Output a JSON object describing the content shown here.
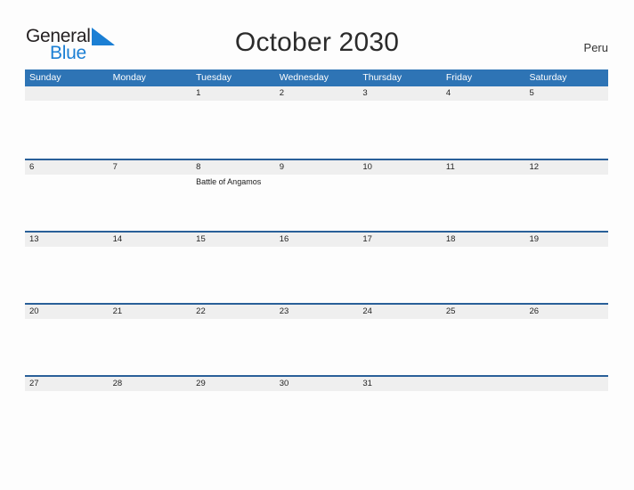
{
  "brand": {
    "name_part_1": "General",
    "name_part_2": "Blue",
    "flag_icon": "blue-triangle-flag-icon",
    "color_dark": "#231f20",
    "color_blue": "#1b7fd4"
  },
  "header": {
    "title": "October 2030",
    "region": "Peru"
  },
  "theme": {
    "header_blue": "#2e74b5",
    "row_divider_blue": "#2a6099",
    "band_gray": "#efefef",
    "page_background": "#fdfdfd"
  },
  "calendar": {
    "month": "October",
    "year": "2030",
    "weekdays": [
      "Sunday",
      "Monday",
      "Tuesday",
      "Wednesday",
      "Thursday",
      "Friday",
      "Saturday"
    ],
    "weeks": [
      [
        {
          "day": "",
          "events": []
        },
        {
          "day": "",
          "events": []
        },
        {
          "day": "1",
          "events": []
        },
        {
          "day": "2",
          "events": []
        },
        {
          "day": "3",
          "events": []
        },
        {
          "day": "4",
          "events": []
        },
        {
          "day": "5",
          "events": []
        }
      ],
      [
        {
          "day": "6",
          "events": []
        },
        {
          "day": "7",
          "events": []
        },
        {
          "day": "8",
          "events": [
            "Battle of Angamos"
          ]
        },
        {
          "day": "9",
          "events": []
        },
        {
          "day": "10",
          "events": []
        },
        {
          "day": "11",
          "events": []
        },
        {
          "day": "12",
          "events": []
        }
      ],
      [
        {
          "day": "13",
          "events": []
        },
        {
          "day": "14",
          "events": []
        },
        {
          "day": "15",
          "events": []
        },
        {
          "day": "16",
          "events": []
        },
        {
          "day": "17",
          "events": []
        },
        {
          "day": "18",
          "events": []
        },
        {
          "day": "19",
          "events": []
        }
      ],
      [
        {
          "day": "20",
          "events": []
        },
        {
          "day": "21",
          "events": []
        },
        {
          "day": "22",
          "events": []
        },
        {
          "day": "23",
          "events": []
        },
        {
          "day": "24",
          "events": []
        },
        {
          "day": "25",
          "events": []
        },
        {
          "day": "26",
          "events": []
        }
      ],
      [
        {
          "day": "27",
          "events": []
        },
        {
          "day": "28",
          "events": []
        },
        {
          "day": "29",
          "events": []
        },
        {
          "day": "30",
          "events": []
        },
        {
          "day": "31",
          "events": []
        },
        {
          "day": "",
          "events": []
        },
        {
          "day": "",
          "events": []
        }
      ]
    ]
  }
}
